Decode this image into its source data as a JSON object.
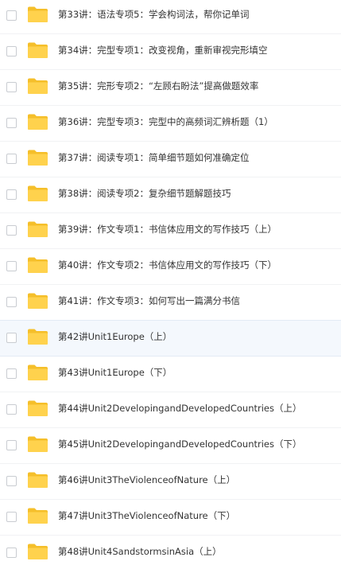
{
  "file_list": {
    "items": [
      {
        "name": "第33讲：语法专项5：学会构词法，帮你记单词"
      },
      {
        "name": "第34讲：完型专项1：改变视角，重新审视完形填空"
      },
      {
        "name": "第35讲：完形专项2：“左顾右盼法”提高做题效率"
      },
      {
        "name": "第36讲：完型专项3：完型中的高频词汇辨析题（1）"
      },
      {
        "name": "第37讲：阅读专项1：简单细节题如何准确定位"
      },
      {
        "name": "第38讲：阅读专项2：复杂细节题解题技巧"
      },
      {
        "name": "第39讲：作文专项1：书信体应用文的写作技巧（上）"
      },
      {
        "name": "第40讲：作文专项2：书信体应用文的写作技巧（下）"
      },
      {
        "name": "第41讲：作文专项3：如何写出一篇满分书信"
      },
      {
        "name": "第42讲Unit1Europe（上）"
      },
      {
        "name": "第43讲Unit1Europe（下）"
      },
      {
        "name": "第44讲Unit2DevelopingandDevelopedCountries（上）"
      },
      {
        "name": "第45讲Unit2DevelopingandDevelopedCountries（下）"
      },
      {
        "name": "第46讲Unit3TheViolenceofNature（上）"
      },
      {
        "name": "第47讲Unit3TheViolenceofNature（下）"
      },
      {
        "name": "第48讲Unit4SandstormsinAsia（上）"
      }
    ],
    "hover_index": 9,
    "icon": "folder-icon",
    "colors": {
      "folder_back": "#f5bf2a",
      "folder_front": "#ffd24d",
      "text": "#333333",
      "hover_bg": "#f4f8fd"
    }
  }
}
